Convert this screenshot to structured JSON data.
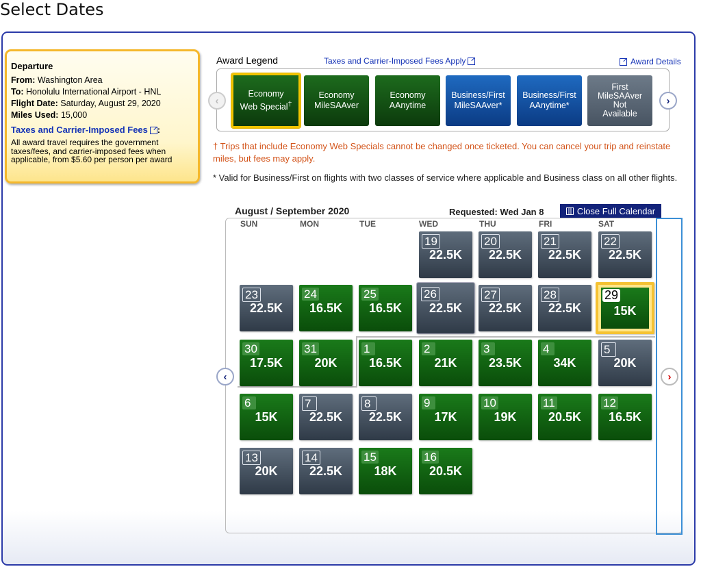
{
  "page": {
    "title": "Select Dates"
  },
  "departure": {
    "heading": "Departure",
    "from_label": "From:",
    "from_value": "Washington Area",
    "to_label": "To:",
    "to_value": "Honolulu International Airport - HNL",
    "date_label": "Flight Date:",
    "date_value": "Saturday, August 29, 2020",
    "miles_label": "Miles Used:",
    "miles_value": "15,000",
    "fees_link": "Taxes and Carrier-Imposed Fees",
    "fees_colon": ":",
    "fees_desc": "All award travel requires the government taxes/fees, and carrier-imposed fees when applicable, from $5.60 per person per award"
  },
  "legend": {
    "title": "Award Legend",
    "fees_link": "Taxes and Carrier-Imposed Fees Apply",
    "details_link": "Award Details",
    "items": [
      {
        "line1": "Economy",
        "line2": "Web Special",
        "sup": "†",
        "style": "green",
        "selected": true
      },
      {
        "line1": "Economy",
        "line2": "MileSAAver",
        "sup": "",
        "style": "green",
        "selected": false
      },
      {
        "line1": "Economy",
        "line2": "AAnytime",
        "sup": "",
        "style": "green",
        "selected": false
      },
      {
        "line1": "Business/First",
        "line2": "MileSAAver*",
        "sup": "",
        "style": "blue",
        "selected": false
      },
      {
        "line1": "Business/First",
        "line2": "AAnytime*",
        "sup": "",
        "style": "blue",
        "selected": false
      },
      {
        "line1": "First",
        "line2": "MileSAAver",
        "line3": "Not",
        "line4": "Available",
        "style": "gray",
        "selected": false
      }
    ],
    "prev_arrow": "‹",
    "next_arrow": "›"
  },
  "notes": {
    "red": "† Trips that include Economy Web Specials cannot be changed once ticketed. You can cancel your trip and reinstate miles, but fees may apply.",
    "black": "* Valid for Business/First on flights with two classes of service where applicable and Business class on all other flights."
  },
  "calendar": {
    "month_title": "August / September 2020",
    "requested": "Requested: Wed Jan 8",
    "close_button": "Close Full Calendar",
    "weekdays": [
      "SUN",
      "MON",
      "TUE",
      "WED",
      "THU",
      "FRI",
      "SAT"
    ],
    "prev_arrow": "‹",
    "next_arrow": "›",
    "days": [
      {
        "day": "19",
        "miles": "22.5K",
        "style": "gray",
        "week": 0,
        "col": 3
      },
      {
        "day": "20",
        "miles": "22.5K",
        "style": "gray",
        "week": 0,
        "col": 4
      },
      {
        "day": "21",
        "miles": "22.5K",
        "style": "gray",
        "week": 0,
        "col": 5
      },
      {
        "day": "22",
        "miles": "22.5K",
        "style": "gray",
        "week": 0,
        "col": 6
      },
      {
        "day": "23",
        "miles": "22.5K",
        "style": "gray",
        "week": 1,
        "col": 0
      },
      {
        "day": "24",
        "miles": "16.5K",
        "style": "green",
        "week": 1,
        "col": 1
      },
      {
        "day": "25",
        "miles": "16.5K",
        "style": "green",
        "week": 1,
        "col": 2
      },
      {
        "day": "26",
        "miles": "22.5K",
        "style": "gray",
        "week": 1,
        "col": 3,
        "requested": true
      },
      {
        "day": "27",
        "miles": "22.5K",
        "style": "gray",
        "week": 1,
        "col": 4
      },
      {
        "day": "28",
        "miles": "22.5K",
        "style": "gray",
        "week": 1,
        "col": 5
      },
      {
        "day": "29",
        "miles": "15K",
        "style": "green",
        "week": 1,
        "col": 6,
        "selected": true
      },
      {
        "day": "30",
        "miles": "17.5K",
        "style": "green",
        "week": 2,
        "col": 0
      },
      {
        "day": "31",
        "miles": "20K",
        "style": "green",
        "week": 2,
        "col": 1
      },
      {
        "day": "1",
        "miles": "16.5K",
        "style": "green",
        "week": 2,
        "col": 2
      },
      {
        "day": "2",
        "miles": "21K",
        "style": "green",
        "week": 2,
        "col": 3
      },
      {
        "day": "3",
        "miles": "23.5K",
        "style": "green",
        "week": 2,
        "col": 4
      },
      {
        "day": "4",
        "miles": "34K",
        "style": "green",
        "week": 2,
        "col": 5
      },
      {
        "day": "5",
        "miles": "20K",
        "style": "gray",
        "week": 2,
        "col": 6
      },
      {
        "day": "6",
        "miles": "15K",
        "style": "green",
        "week": 3,
        "col": 0
      },
      {
        "day": "7",
        "miles": "22.5K",
        "style": "gray",
        "week": 3,
        "col": 1
      },
      {
        "day": "8",
        "miles": "22.5K",
        "style": "gray",
        "week": 3,
        "col": 2
      },
      {
        "day": "9",
        "miles": "17K",
        "style": "green",
        "week": 3,
        "col": 3
      },
      {
        "day": "10",
        "miles": "19K",
        "style": "green",
        "week": 3,
        "col": 4
      },
      {
        "day": "11",
        "miles": "20.5K",
        "style": "green",
        "week": 3,
        "col": 5
      },
      {
        "day": "12",
        "miles": "16.5K",
        "style": "green",
        "week": 3,
        "col": 6
      },
      {
        "day": "13",
        "miles": "20K",
        "style": "gray",
        "week": 4,
        "col": 0
      },
      {
        "day": "14",
        "miles": "22.5K",
        "style": "gray",
        "week": 4,
        "col": 1
      },
      {
        "day": "15",
        "miles": "18K",
        "style": "green",
        "week": 4,
        "col": 2
      },
      {
        "day": "16",
        "miles": "20.5K",
        "style": "green",
        "week": 4,
        "col": 3
      }
    ]
  },
  "colors": {
    "brand_navy": "#13237a",
    "link_blue": "#1533b6",
    "award_green": "#0a4d0a",
    "unavailable_gray": "#485462",
    "business_blue": "#0b3b84",
    "highlight_gold": "#f5c233",
    "notice_orange": "#d3541a"
  }
}
